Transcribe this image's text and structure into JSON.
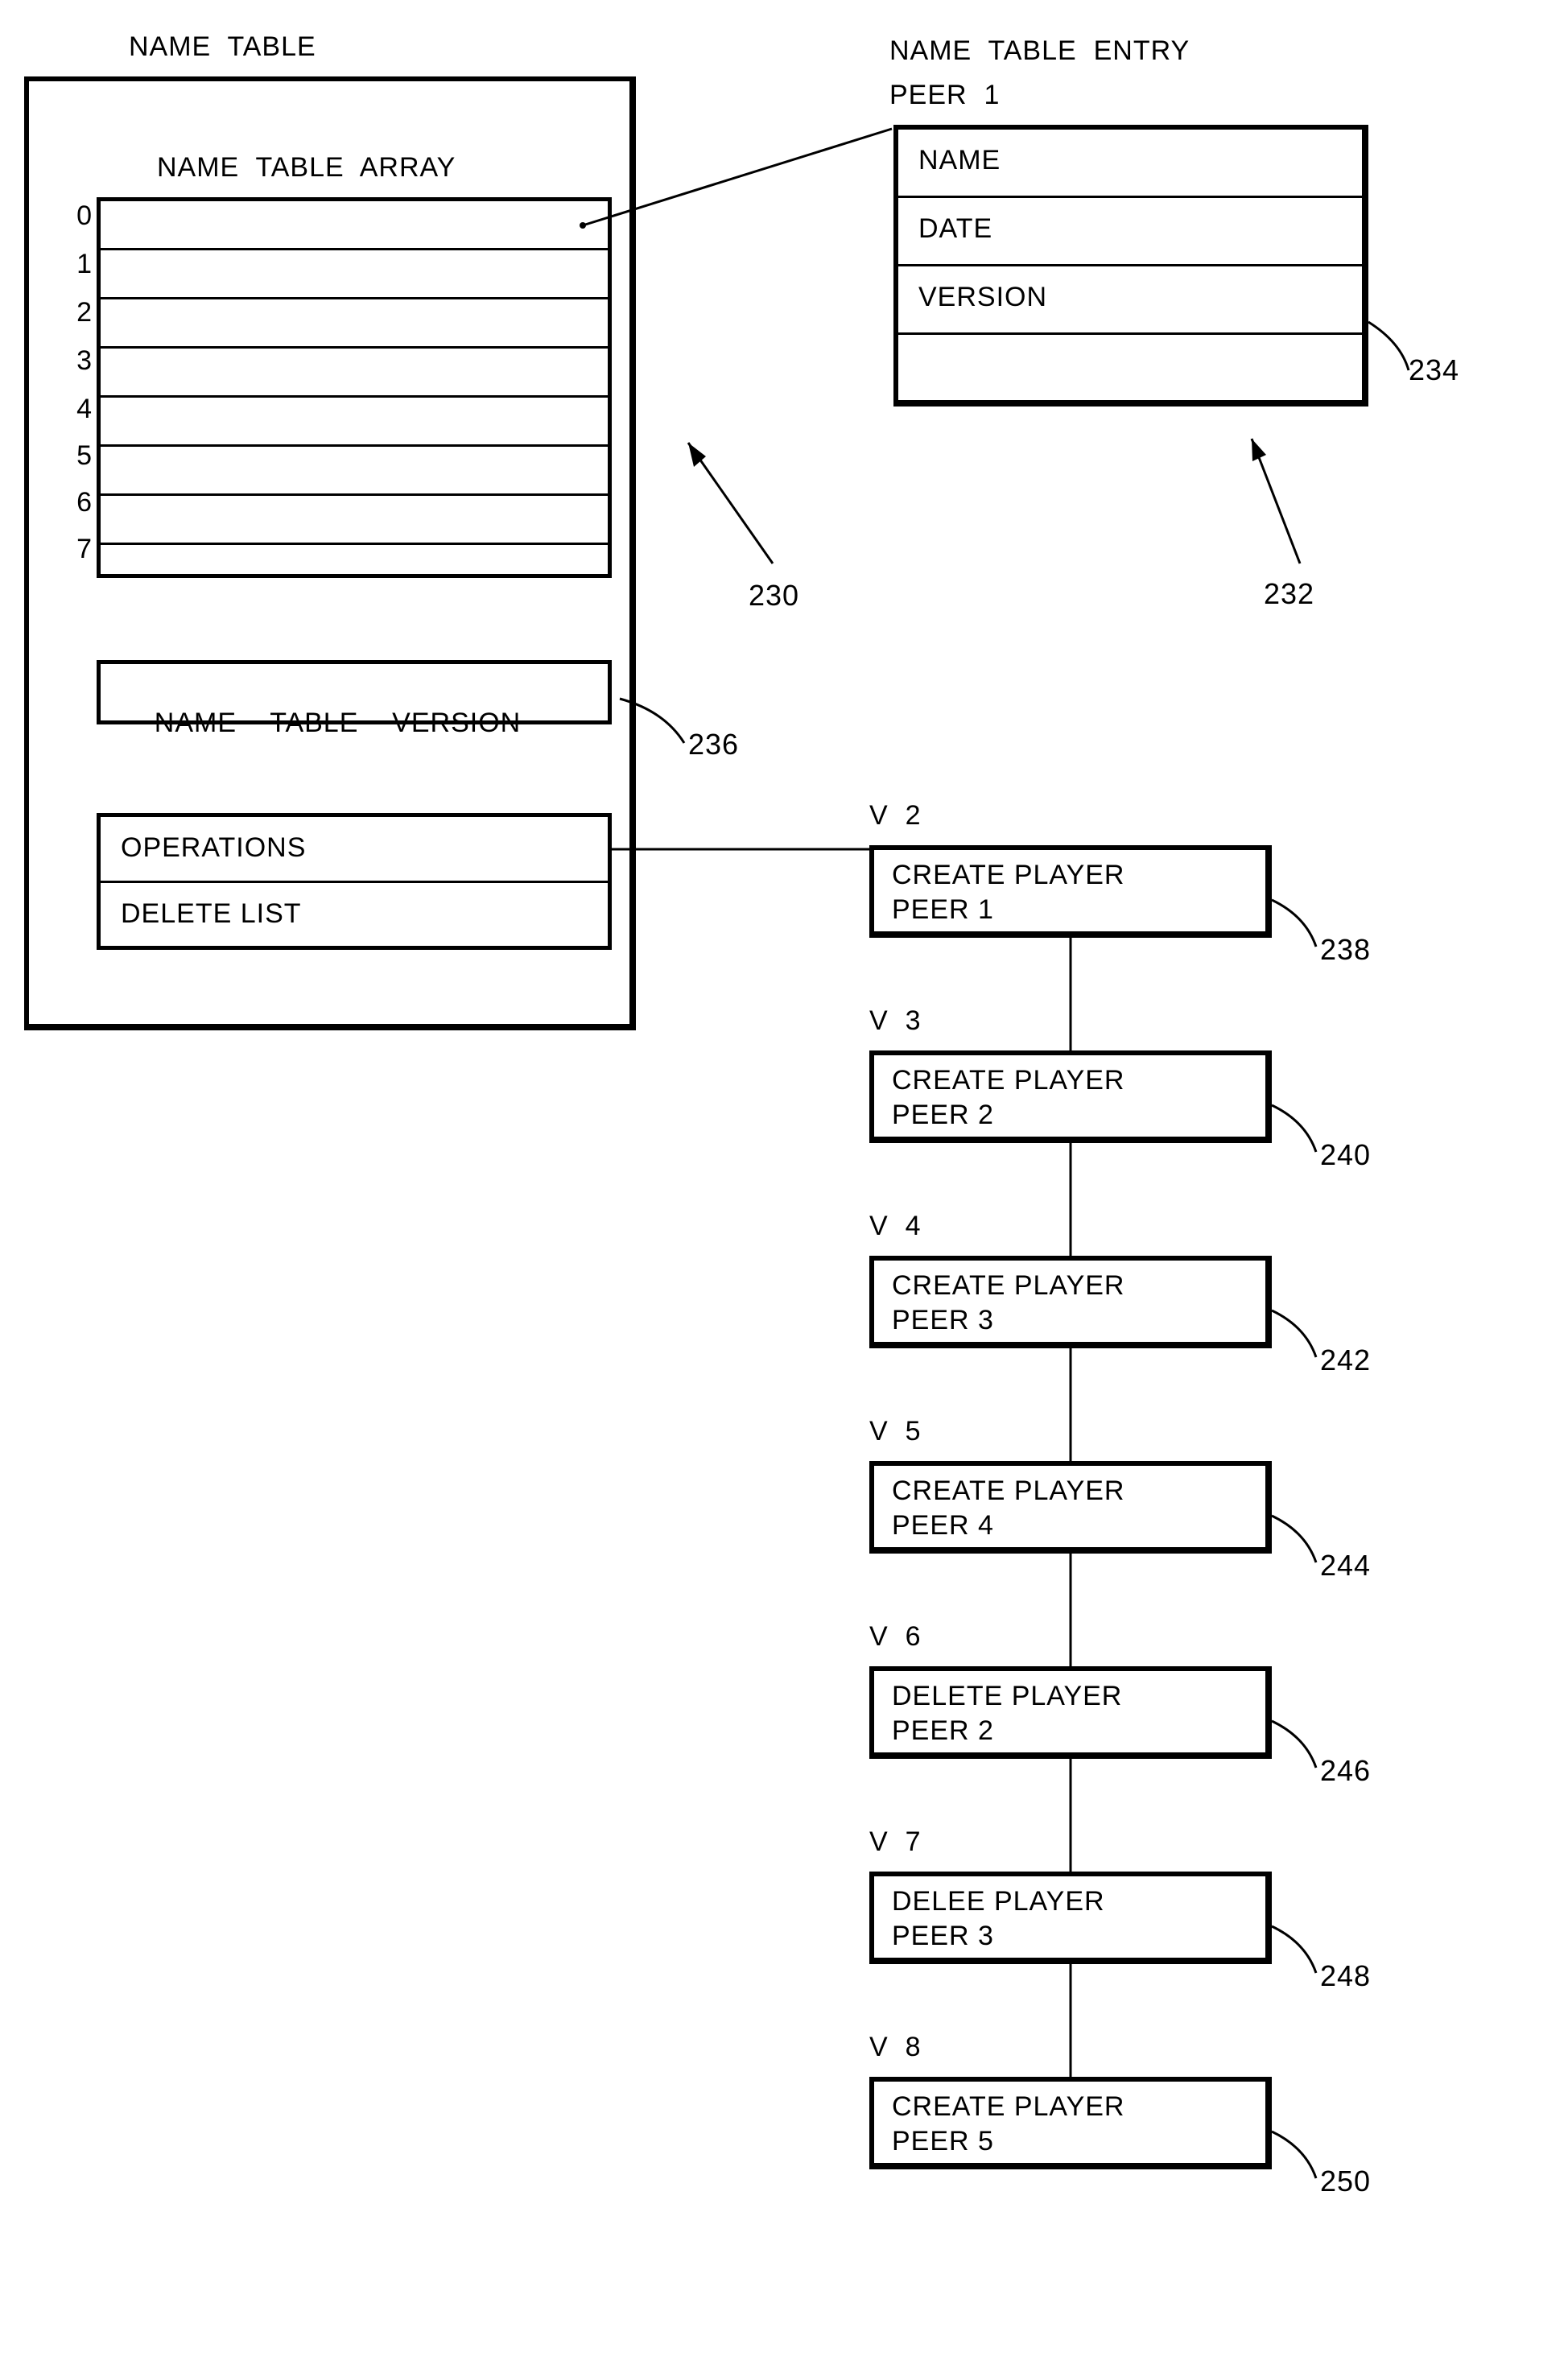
{
  "labels": {
    "name_table": "NAME  TABLE",
    "name_table_array": "NAME  TABLE  ARRAY",
    "name_table_entry_header": "NAME  TABLE  ENTRY",
    "peer1": "PEER  1",
    "entry_name": "NAME",
    "entry_date": "DATE",
    "entry_version": "VERSION",
    "name_table_version": "NAME    TABLE    VERSION",
    "operations": "OPERATIONS",
    "delete_list": "DELETE  LIST"
  },
  "array_indices": [
    "0",
    "1",
    "2",
    "3",
    "4",
    "5",
    "6",
    "7"
  ],
  "ref": {
    "r230": "230",
    "r232": "232",
    "r234": "234",
    "r236": "236",
    "r238": "238",
    "r240": "240",
    "r242": "242",
    "r244": "244",
    "r246": "246",
    "r248": "248",
    "r250": "250"
  },
  "ops": [
    {
      "v": "V  2",
      "l1": "CREATE PLAYER",
      "l2": "PEER  1"
    },
    {
      "v": "V  3",
      "l1": "CREATE PLAYER",
      "l2": "PEER  2"
    },
    {
      "v": "V  4",
      "l1": "CREATE PLAYER",
      "l2": "PEER  3"
    },
    {
      "v": "V  5",
      "l1": "CREATE PLAYER",
      "l2": "PEER  4"
    },
    {
      "v": "V  6",
      "l1": "DELETE PLAYER",
      "l2": "PEER  2"
    },
    {
      "v": "V  7",
      "l1": "DELEE PLAYER",
      "l2": "PEER  3"
    },
    {
      "v": "V  8",
      "l1": "CREATE PLAYER",
      "l2": "PEER  5"
    }
  ]
}
